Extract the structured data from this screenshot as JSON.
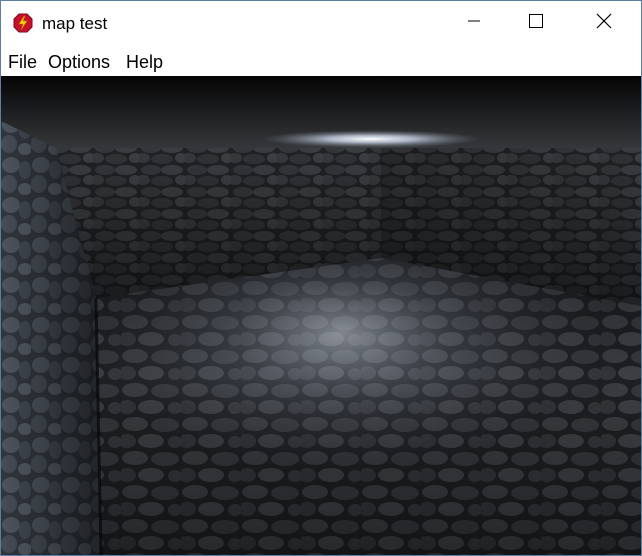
{
  "window": {
    "title": "map test",
    "icon": "app-icon",
    "controls": {
      "minimize": "minimize-icon",
      "maximize": "maximize-icon",
      "close": "close-icon"
    }
  },
  "menubar": {
    "file": "File",
    "options": "Options",
    "help": "Help"
  },
  "viewport": {
    "scene": "3d-stone-room"
  }
}
